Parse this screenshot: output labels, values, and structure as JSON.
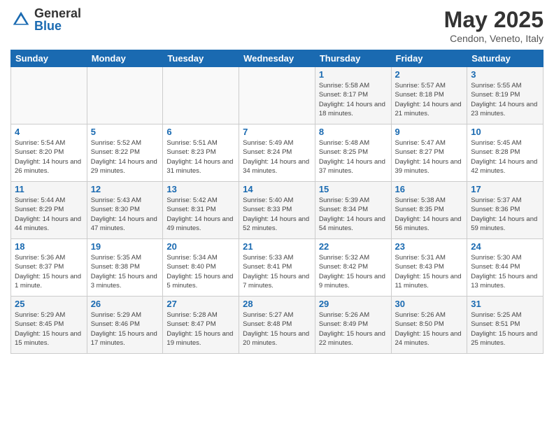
{
  "header": {
    "logo_general": "General",
    "logo_blue": "Blue",
    "title": "May 2025",
    "subtitle": "Cendon, Veneto, Italy"
  },
  "days_of_week": [
    "Sunday",
    "Monday",
    "Tuesday",
    "Wednesday",
    "Thursday",
    "Friday",
    "Saturday"
  ],
  "weeks": [
    [
      {
        "day": "",
        "empty": true
      },
      {
        "day": "",
        "empty": true
      },
      {
        "day": "",
        "empty": true
      },
      {
        "day": "",
        "empty": true
      },
      {
        "day": "1",
        "sunrise": "5:58 AM",
        "sunset": "8:17 PM",
        "daylight": "14 hours and 18 minutes."
      },
      {
        "day": "2",
        "sunrise": "5:57 AM",
        "sunset": "8:18 PM",
        "daylight": "14 hours and 21 minutes."
      },
      {
        "day": "3",
        "sunrise": "5:55 AM",
        "sunset": "8:19 PM",
        "daylight": "14 hours and 23 minutes."
      }
    ],
    [
      {
        "day": "4",
        "sunrise": "5:54 AM",
        "sunset": "8:20 PM",
        "daylight": "14 hours and 26 minutes."
      },
      {
        "day": "5",
        "sunrise": "5:52 AM",
        "sunset": "8:22 PM",
        "daylight": "14 hours and 29 minutes."
      },
      {
        "day": "6",
        "sunrise": "5:51 AM",
        "sunset": "8:23 PM",
        "daylight": "14 hours and 31 minutes."
      },
      {
        "day": "7",
        "sunrise": "5:49 AM",
        "sunset": "8:24 PM",
        "daylight": "14 hours and 34 minutes."
      },
      {
        "day": "8",
        "sunrise": "5:48 AM",
        "sunset": "8:25 PM",
        "daylight": "14 hours and 37 minutes."
      },
      {
        "day": "9",
        "sunrise": "5:47 AM",
        "sunset": "8:27 PM",
        "daylight": "14 hours and 39 minutes."
      },
      {
        "day": "10",
        "sunrise": "5:45 AM",
        "sunset": "8:28 PM",
        "daylight": "14 hours and 42 minutes."
      }
    ],
    [
      {
        "day": "11",
        "sunrise": "5:44 AM",
        "sunset": "8:29 PM",
        "daylight": "14 hours and 44 minutes."
      },
      {
        "day": "12",
        "sunrise": "5:43 AM",
        "sunset": "8:30 PM",
        "daylight": "14 hours and 47 minutes."
      },
      {
        "day": "13",
        "sunrise": "5:42 AM",
        "sunset": "8:31 PM",
        "daylight": "14 hours and 49 minutes."
      },
      {
        "day": "14",
        "sunrise": "5:40 AM",
        "sunset": "8:33 PM",
        "daylight": "14 hours and 52 minutes."
      },
      {
        "day": "15",
        "sunrise": "5:39 AM",
        "sunset": "8:34 PM",
        "daylight": "14 hours and 54 minutes."
      },
      {
        "day": "16",
        "sunrise": "5:38 AM",
        "sunset": "8:35 PM",
        "daylight": "14 hours and 56 minutes."
      },
      {
        "day": "17",
        "sunrise": "5:37 AM",
        "sunset": "8:36 PM",
        "daylight": "14 hours and 59 minutes."
      }
    ],
    [
      {
        "day": "18",
        "sunrise": "5:36 AM",
        "sunset": "8:37 PM",
        "daylight": "15 hours and 1 minute."
      },
      {
        "day": "19",
        "sunrise": "5:35 AM",
        "sunset": "8:38 PM",
        "daylight": "15 hours and 3 minutes."
      },
      {
        "day": "20",
        "sunrise": "5:34 AM",
        "sunset": "8:40 PM",
        "daylight": "15 hours and 5 minutes."
      },
      {
        "day": "21",
        "sunrise": "5:33 AM",
        "sunset": "8:41 PM",
        "daylight": "15 hours and 7 minutes."
      },
      {
        "day": "22",
        "sunrise": "5:32 AM",
        "sunset": "8:42 PM",
        "daylight": "15 hours and 9 minutes."
      },
      {
        "day": "23",
        "sunrise": "5:31 AM",
        "sunset": "8:43 PM",
        "daylight": "15 hours and 11 minutes."
      },
      {
        "day": "24",
        "sunrise": "5:30 AM",
        "sunset": "8:44 PM",
        "daylight": "15 hours and 13 minutes."
      }
    ],
    [
      {
        "day": "25",
        "sunrise": "5:29 AM",
        "sunset": "8:45 PM",
        "daylight": "15 hours and 15 minutes."
      },
      {
        "day": "26",
        "sunrise": "5:29 AM",
        "sunset": "8:46 PM",
        "daylight": "15 hours and 17 minutes."
      },
      {
        "day": "27",
        "sunrise": "5:28 AM",
        "sunset": "8:47 PM",
        "daylight": "15 hours and 19 minutes."
      },
      {
        "day": "28",
        "sunrise": "5:27 AM",
        "sunset": "8:48 PM",
        "daylight": "15 hours and 20 minutes."
      },
      {
        "day": "29",
        "sunrise": "5:26 AM",
        "sunset": "8:49 PM",
        "daylight": "15 hours and 22 minutes."
      },
      {
        "day": "30",
        "sunrise": "5:26 AM",
        "sunset": "8:50 PM",
        "daylight": "15 hours and 24 minutes."
      },
      {
        "day": "31",
        "sunrise": "5:25 AM",
        "sunset": "8:51 PM",
        "daylight": "15 hours and 25 minutes."
      }
    ]
  ],
  "labels": {
    "sunrise_prefix": "Sunrise: ",
    "sunset_prefix": "Sunset: ",
    "daylight_prefix": "Daylight: "
  }
}
